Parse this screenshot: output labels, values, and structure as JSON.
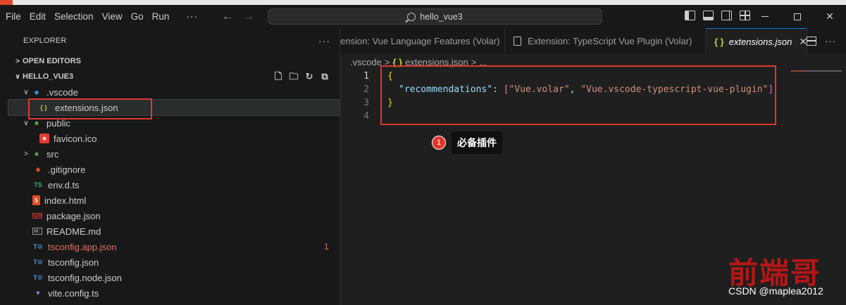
{
  "menu": [
    "File",
    "Edit",
    "Selection",
    "View",
    "Go",
    "Run",
    "···"
  ],
  "search": {
    "text": "hello_vue3"
  },
  "sidebar": {
    "header": "EXPLORER",
    "more": "···",
    "open_editors": "OPEN EDITORS",
    "project": "HELLO_VUE3",
    "items": [
      {
        "label": ".vscode",
        "icon": "vscode-folder-icon",
        "chev": "∨",
        "indent": 1
      },
      {
        "label": "extensions.json",
        "icon": "{ }",
        "indent": 2
      },
      {
        "label": "public",
        "icon": "public-folder-icon",
        "chev": "∨",
        "indent": 1
      },
      {
        "label": "favicon.ico",
        "icon": "favicon-icon",
        "indent": 2
      },
      {
        "label": "src",
        "icon": "src-folder-icon",
        "chev": ">",
        "indent": 1
      },
      {
        "label": ".gitignore",
        "icon": "git-icon",
        "indent": 1
      },
      {
        "label": "env.d.ts",
        "icon": "TS",
        "indent": 1
      },
      {
        "label": "index.html",
        "icon": "html-icon",
        "indent": 1
      },
      {
        "label": "package.json",
        "icon": "npm-icon",
        "indent": 1
      },
      {
        "label": "README.md",
        "icon": "markdown-icon",
        "indent": 1
      },
      {
        "label": "tsconfig.app.json",
        "icon": "tsconfig-icon",
        "indent": 1,
        "badge": "1"
      },
      {
        "label": "tsconfig.json",
        "icon": "tsconfig-icon",
        "indent": 1
      },
      {
        "label": "tsconfig.node.json",
        "icon": "tsconfig-icon",
        "indent": 1
      },
      {
        "label": "vite.config.ts",
        "icon": "vite-icon",
        "indent": 1
      }
    ]
  },
  "tabs": [
    {
      "title": "ension: Vue Language Features (Volar)"
    },
    {
      "title": "Extension: TypeScript Vue Plugin (Volar)"
    },
    {
      "title": "extensions.json",
      "icon": "{ }",
      "close": "✕"
    }
  ],
  "breadcrumbs": {
    "folder": ".vscode",
    "sep": ">",
    "icon": "{ }",
    "file": "extensions.json",
    "more": "..."
  },
  "code": {
    "line_numbers": [
      "1",
      "2",
      "3",
      "4"
    ],
    "open": "{",
    "key": "\"recommendations\"",
    "colon": ": ",
    "bracket_open": "[",
    "value1": "\"Vue.volar\"",
    "comma": ", ",
    "value2": "\"Vue.vscode-typescript-vue-plugin\"",
    "bracket_close": "]",
    "close": "}"
  },
  "callout": {
    "number": "1",
    "text": "必备插件"
  },
  "watermark": {
    "text": "前端哥",
    "csdn": "CSDN @maplea2012"
  }
}
